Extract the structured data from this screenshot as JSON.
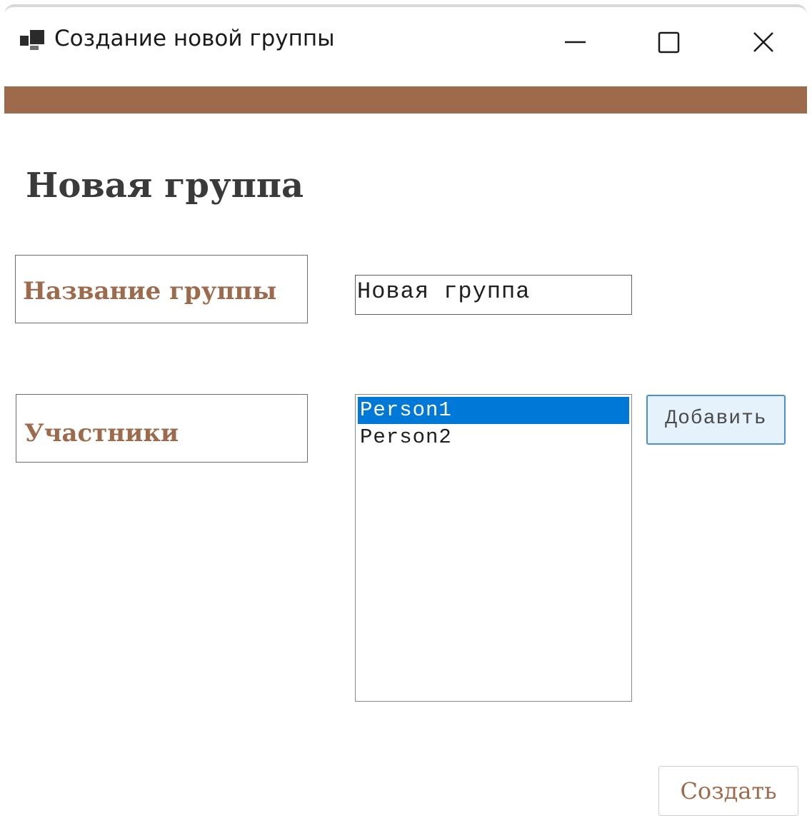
{
  "window": {
    "title": "Создание новой группы",
    "icon": "app-window-icon",
    "controls": {
      "minimize_icon": "minimize-icon",
      "maximize_icon": "maximize-icon",
      "close_icon": "close-icon"
    }
  },
  "colors": {
    "accent": "#9e6a4c",
    "selection": "#0078d7",
    "heading": "#3a3a3a"
  },
  "main": {
    "heading": "Новая группа",
    "group_name_label": "Название группы",
    "group_name_value": "Новая группа",
    "members_label": "Участники",
    "members": [
      "Person1",
      "Person2"
    ],
    "selected_member": "Person1",
    "add_button": "Добавить",
    "create_button": "Создать"
  }
}
